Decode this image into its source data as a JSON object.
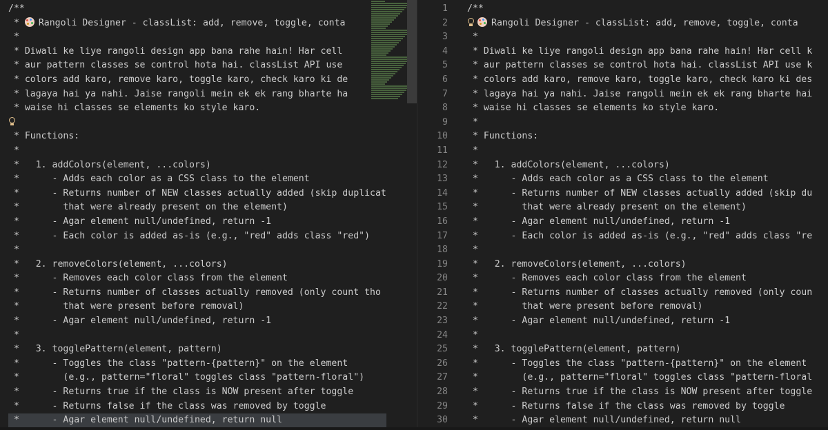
{
  "editor": {
    "left_lines": [
      "/**",
      " * Rangoli Designer - classList: add, remove, toggle, conta",
      " *",
      " * Diwali ke liye rangoli design app bana rahe hain! Har cell",
      " * aur pattern classes se control hota hai. classList API use",
      " * colors add karo, remove karo, toggle karo, check karo ki de",
      " * lagaya hai ya nahi. Jaise rangoli mein ek ek rang bharte ha",
      " * waise hi classes se elements ko style karo.",
      " *",
      " * Functions:",
      " *",
      " *   1. addColors(element, ...colors)",
      " *      - Adds each color as a CSS class to the element",
      " *      - Returns number of NEW classes actually added (skip duplicat",
      " *        that were already present on the element)",
      " *      - Agar element null/undefined, return -1",
      " *      - Each color is added as-is (e.g., \"red\" adds class \"red\")",
      " *",
      " *   2. removeColors(element, ...colors)",
      " *      - Removes each color class from the element",
      " *      - Returns number of classes actually removed (only count tho",
      " *        that were present before removal)",
      " *      - Agar element null/undefined, return -1",
      " *",
      " *   3. togglePattern(element, pattern)",
      " *      - Toggles the class \"pattern-{pattern}\" on the element",
      " *        (e.g., pattern=\"floral\" toggles class \"pattern-floral\")",
      " *      - Returns true if the class is NOW present after toggle",
      " *      - Returns false if the class was removed by toggle",
      " *      - Agar element null/undefined, return null"
    ],
    "right_lines": [
      "/**",
      " * Rangoli Designer - classList: add, remove, toggle, conta",
      " *",
      " * Diwali ke liye rangoli design app bana rahe hain! Har cell k",
      " * aur pattern classes se control hota hai. classList API use k",
      " * colors add karo, remove karo, toggle karo, check karo ki des",
      " * lagaya hai ya nahi. Jaise rangoli mein ek ek rang bharte hai",
      " * waise hi classes se elements ko style karo.",
      " *",
      " * Functions:",
      " *",
      " *   1. addColors(element, ...colors)",
      " *      - Adds each color as a CSS class to the element",
      " *      - Returns number of NEW classes actually added (skip du",
      " *        that were already present on the element)",
      " *      - Agar element null/undefined, return -1",
      " *      - Each color is added as-is (e.g., \"red\" adds class \"re",
      " *",
      " *   2. removeColors(element, ...colors)",
      " *      - Removes each color class from the element",
      " *      - Returns number of classes actually removed (only coun",
      " *        that were present before removal)",
      " *      - Agar element null/undefined, return -1",
      " *",
      " *   3. togglePattern(element, pattern)",
      " *      - Toggles the class \"pattern-{pattern}\" on the element",
      " *        (e.g., pattern=\"floral\" toggles class \"pattern-floral",
      " *      - Returns true if the class is NOW present after toggle",
      " *      - Returns false if the class was removed by toggle",
      " *      - Agar element null/undefined, return null"
    ],
    "line_numbers": [
      "1",
      "2",
      "3",
      "4",
      "5",
      "6",
      "7",
      "8",
      "9",
      "10",
      "11",
      "12",
      "13",
      "14",
      "15",
      "16",
      "17",
      "18",
      "19",
      "20",
      "21",
      "22",
      "23",
      "24",
      "25",
      "26",
      "27",
      "28",
      "29",
      "30"
    ],
    "icons": {
      "lightbulb": "lightbulb-icon",
      "palette": "palette-icon"
    },
    "colors": {
      "background": "#1f1f1f",
      "text": "#cccccc",
      "line_number": "#858585",
      "lightbulb": "#e2c08d"
    }
  }
}
